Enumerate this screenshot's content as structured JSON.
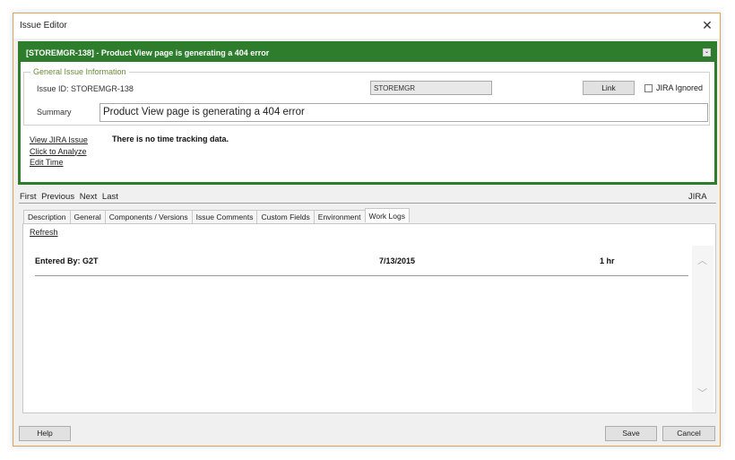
{
  "window": {
    "title": "Issue Editor",
    "close": "✕"
  },
  "issue": {
    "header": "[STOREMGR-138] - Product View page is generating a 404 error",
    "collapse_icon": "⌄",
    "group_label": "General Issue Information",
    "issue_id": "Issue ID: STOREMGR-138",
    "project": "STOREMGR",
    "link_label": "Link",
    "jira_ignored_label": "JIRA Ignored",
    "jira_ignored_checked": false,
    "summary_label": "Summary",
    "summary": "Product View page is generating a 404 error"
  },
  "actions": {
    "view_jira": "View JIRA Issue",
    "analyze": "Click to Analyze",
    "edit_time": "Edit Time",
    "no_tracking": "There is no time tracking data."
  },
  "pager": {
    "first": "First",
    "previous": "Previous",
    "next": "Next",
    "last": "Last",
    "jira": "JIRA"
  },
  "tabs": [
    {
      "label": "Description"
    },
    {
      "label": "General"
    },
    {
      "label": "Components / Versions"
    },
    {
      "label": "Issue Comments"
    },
    {
      "label": "Custom Fields"
    },
    {
      "label": "Environment"
    },
    {
      "label": "Work Logs"
    }
  ],
  "active_tab": "Work Logs",
  "worklogs": {
    "refresh": "Refresh",
    "entries": [
      {
        "entered_by": "Entered By: G2T",
        "date": "7/13/2015",
        "duration": "1 hr"
      }
    ]
  },
  "buttons": {
    "help": "Help",
    "save": "Save",
    "cancel": "Cancel"
  },
  "colors": {
    "header_green": "#2d7d2d",
    "legend_green": "#6d8a3a",
    "window_border": "#e0a35a"
  }
}
